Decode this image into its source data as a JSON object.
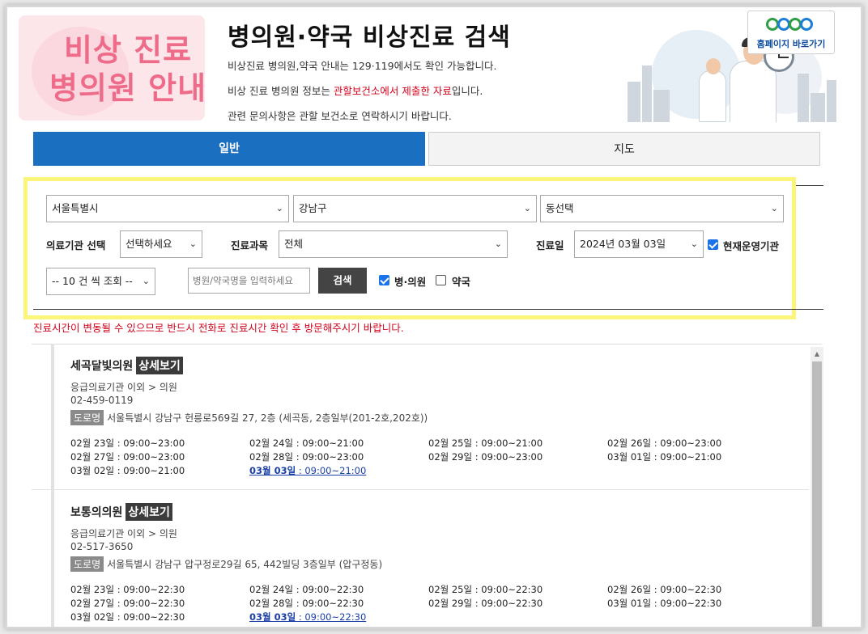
{
  "banner": {
    "line1": "비상 진료",
    "line2": "병의원 안내"
  },
  "header": {
    "title": "병의원·약국 비상진료 검색",
    "desc1": "비상진료 병의원,약국 안내는 129·119에서도 확인 가능합니다.",
    "desc2_pre": "비상 진료 병의원 정보는 ",
    "desc2_red": "관할보건소에서 제출한 자료",
    "desc2_post": "입니다.",
    "desc3": "관련 문의사항은 관할 보건소로 연락하시기 바랍니다.",
    "home_label": "홈페이지 바로가기"
  },
  "tabs": {
    "general": "일반",
    "map": "지도"
  },
  "filters": {
    "city": "서울특별시",
    "district": "강남구",
    "dong": "동선택",
    "facility_label": "의료기관 선택",
    "facility_value": "선택하세요",
    "dept_label": "진료과목",
    "dept_value": "전체",
    "date_label": "진료일",
    "date_value": "2024년 03월 03일",
    "operating_label": "현재운영기관",
    "operating_checked": true,
    "page_size": "-- 10 건 씩 조회 --",
    "search_placeholder": "병원/약국명을 입력하세요",
    "search_button": "검색",
    "hospital_label": "병·의원",
    "hospital_checked": true,
    "pharmacy_label": "약국",
    "pharmacy_checked": false
  },
  "notice": "진료시간이 변동될 수 있으므로 반드시 전화로 진료시간 확인 후 방문해주시기 바랍니다.",
  "detail_label": "상세보기",
  "road_label": "도로명",
  "results": [
    {
      "name": "세곡달빛의원",
      "type": "응급의료기관 이외 > 의원",
      "phone": "02-459-0119",
      "address": "서울특별시 강남구 헌릉로569길 27, 2층 (세곡동, 2층일부(201-2호,202호))",
      "hours": [
        "02월 23일 : 09:00~23:00",
        "02월 24일 : 09:00~21:00",
        "02월 25일 : 09:00~21:00",
        "02월 26일 : 09:00~23:00",
        "02월 27일 : 09:00~23:00",
        "02월 28일 : 09:00~23:00",
        "02월 29일 : 09:00~23:00",
        "03월 01일 : 09:00~21:00",
        "03월 02일 : 09:00~21:00"
      ],
      "today_date": "03월 03일",
      "today_time": " : 09:00~21:00"
    },
    {
      "name": "보통의의원",
      "type": "응급의료기관 이외 > 의원",
      "phone": "02-517-3650",
      "address": "서울특별시 강남구 압구정로29길 65, 442빌딩 3층일부 (압구정동)",
      "hours": [
        "02월 23일 : 09:00~22:30",
        "02월 24일 : 09:00~22:30",
        "02월 25일 : 09:00~22:30",
        "02월 26일 : 09:00~22:30",
        "02월 27일 : 09:00~22:30",
        "02월 28일 : 09:00~22:30",
        "02월 29일 : 09:00~22:30",
        "03월 01일 : 09:00~22:30",
        "03월 02일 : 09:00~22:30"
      ],
      "today_date": "03월 03일",
      "today_time": " : 09:00~22:30"
    }
  ]
}
